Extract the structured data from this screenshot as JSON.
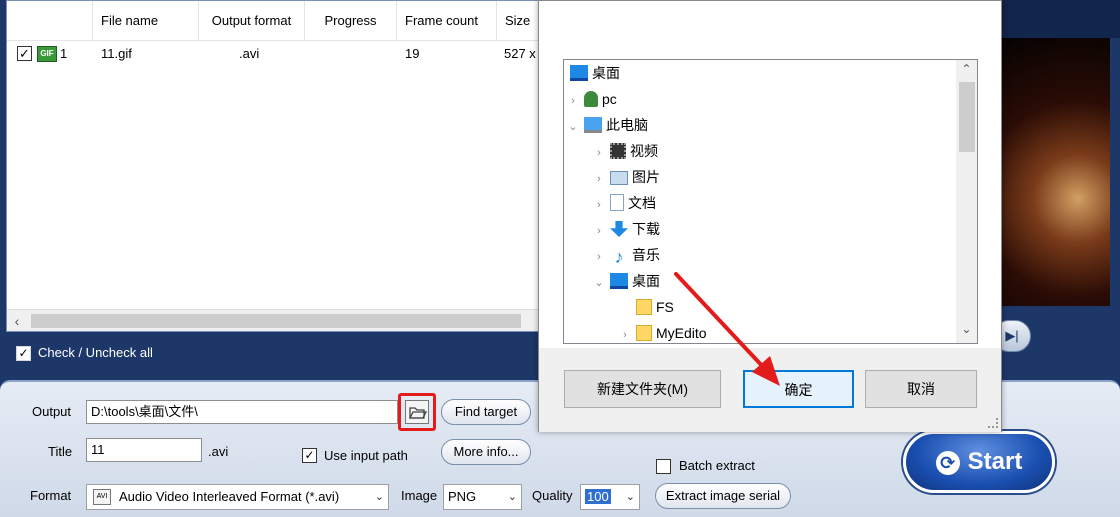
{
  "file_list": {
    "columns": [
      "File name",
      "Output format",
      "Progress",
      "Frame count",
      "Size"
    ],
    "rows": [
      {
        "index": "1",
        "icon": "GIF",
        "name": "11.gif",
        "format": ".avi",
        "progress": "",
        "frames": "19",
        "size": "527 x"
      }
    ],
    "check_all_label": "Check / Uncheck all"
  },
  "settings": {
    "output_label": "Output",
    "output_path": "D:\\tools\\桌面\\文件\\",
    "find_target": "Find target",
    "title_label": "Title",
    "title_value": "11",
    "title_ext": ".avi",
    "use_input_path": "Use input path",
    "more_info": "More info...",
    "format_label": "Format",
    "format_value": "Audio Video Interleaved Format (*.avi)",
    "image_label": "Image",
    "image_value": "PNG",
    "quality_label": "Quality",
    "quality_value": "100",
    "batch_extract": "Batch extract",
    "extract_serial": "Extract image serial",
    "start": "Start"
  },
  "dialog": {
    "tree": [
      {
        "label": "桌面",
        "icon": "desktop-icon",
        "expander": ""
      },
      {
        "label": "pc",
        "icon": "user-icon",
        "expander": "›"
      },
      {
        "label": "此电脑",
        "icon": "computer-icon",
        "expander": "⌄"
      },
      {
        "label": "视频",
        "icon": "video-folder-icon",
        "expander": "›"
      },
      {
        "label": "图片",
        "icon": "pictures-folder-icon",
        "expander": "›"
      },
      {
        "label": "文档",
        "icon": "documents-folder-icon",
        "expander": "›"
      },
      {
        "label": "下载",
        "icon": "download-folder-icon",
        "expander": "›"
      },
      {
        "label": "音乐",
        "icon": "music-folder-icon",
        "expander": "›"
      },
      {
        "label": "桌面",
        "icon": "desktop-icon",
        "expander": "⌄"
      },
      {
        "label": "FS",
        "icon": "folder-icon",
        "expander": ""
      },
      {
        "label": "MyEdito",
        "icon": "folder-icon",
        "expander": "›"
      }
    ],
    "new_folder": "新建文件夹(M)",
    "ok": "确定",
    "cancel": "取消"
  },
  "colors": {
    "app_bg": "#1d3768",
    "highlight_red": "#e31b1b",
    "dialog_default_border": "#0078d7"
  }
}
